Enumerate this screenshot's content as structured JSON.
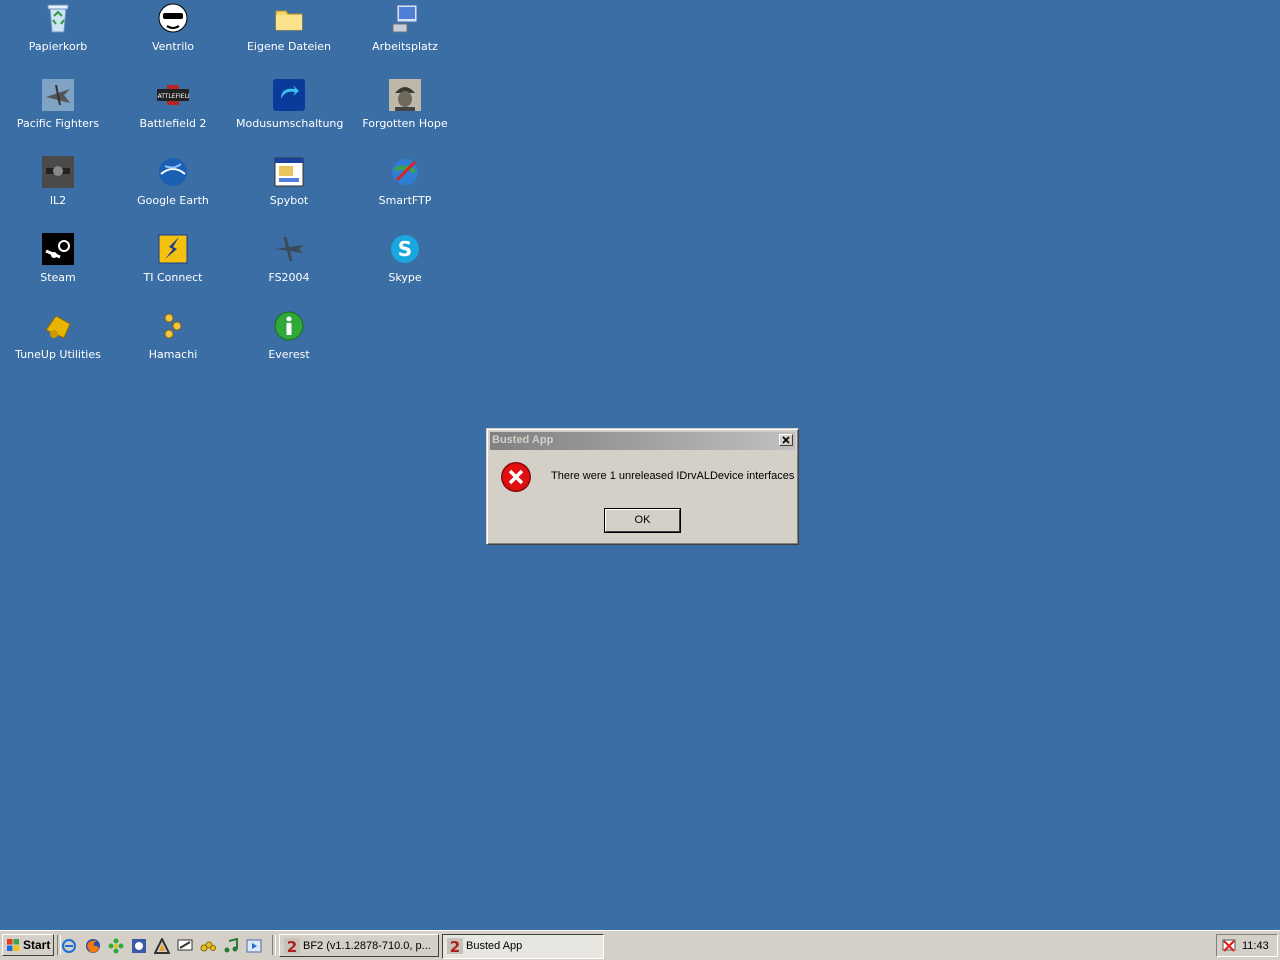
{
  "desktop": {
    "icons": [
      {
        "label": "Papierkorb",
        "icon": "recycle-bin-icon"
      },
      {
        "label": "Ventrilo",
        "icon": "ventrilo-icon"
      },
      {
        "label": "Eigene Dateien",
        "icon": "folder-icon"
      },
      {
        "label": "Arbeitsplatz",
        "icon": "my-computer-icon"
      },
      {
        "label": "Pacific Fighters",
        "icon": "pacific-fighters-icon"
      },
      {
        "label": "Battlefield 2",
        "icon": "battlefield2-icon"
      },
      {
        "label": "Modusumschaltung",
        "icon": "mode-switch-icon"
      },
      {
        "label": "Forgotten Hope",
        "icon": "forgotten-hope-icon"
      },
      {
        "label": "IL2",
        "icon": "il2-icon"
      },
      {
        "label": "Google Earth",
        "icon": "google-earth-icon"
      },
      {
        "label": "Spybot",
        "icon": "spybot-icon"
      },
      {
        "label": "SmartFTP",
        "icon": "smartftp-icon"
      },
      {
        "label": "Steam",
        "icon": "steam-icon"
      },
      {
        "label": "TI Connect",
        "icon": "ti-connect-icon"
      },
      {
        "label": "FS2004",
        "icon": "fs2004-icon"
      },
      {
        "label": "Skype",
        "icon": "skype-icon"
      },
      {
        "label": "TuneUp Utilities",
        "icon": "tuneup-icon"
      },
      {
        "label": "Hamachi",
        "icon": "hamachi-icon"
      },
      {
        "label": "Everest",
        "icon": "everest-icon"
      }
    ]
  },
  "dialog": {
    "title": "Busted App",
    "message": "There were 1 unreleased IDrvALDevice interfaces",
    "ok_label": "OK",
    "icon": "error-icon"
  },
  "taskbar": {
    "start_label": "Start",
    "quicklaunch": [
      "ie-icon",
      "firefox-icon",
      "icq-icon",
      "media-icon",
      "winamp-icon",
      "desktop-icon",
      "hamachi-icon",
      "itunes-icon",
      "player-icon"
    ],
    "tasks": [
      {
        "label": "BF2 (v1.1.2878-710.0, p...",
        "icon": "bf2-icon",
        "active": false
      },
      {
        "label": "Busted App",
        "icon": "bf2-icon",
        "active": true
      }
    ],
    "clock": "11:43"
  },
  "colors": {
    "desktop": "#3a6ea5",
    "error": "#d0021b"
  }
}
